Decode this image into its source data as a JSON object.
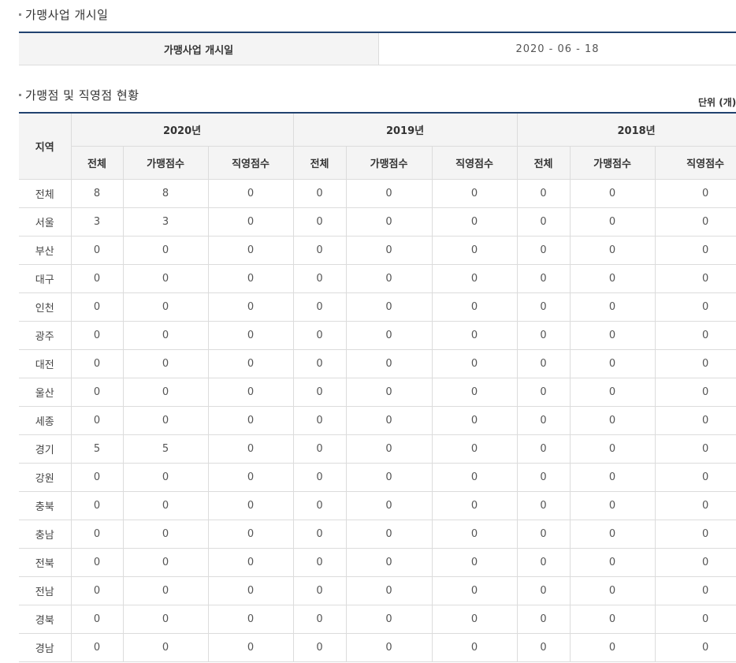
{
  "section1": {
    "title": "가맹사업 개시일",
    "label": "가맹사업 개시일",
    "value": "2020 - 06 - 18"
  },
  "section2": {
    "title": "가맹점 및 직영점 현황",
    "unit": "단위 (개)",
    "region_header": "지역",
    "years": [
      "2020년",
      "2019년",
      "2018년"
    ],
    "sub_headers": [
      "전체",
      "가맹점수",
      "직영점수"
    ],
    "rows": [
      {
        "region": "전체",
        "values": [
          "8",
          "8",
          "0",
          "0",
          "0",
          "0",
          "0",
          "0",
          "0"
        ]
      },
      {
        "region": "서울",
        "values": [
          "3",
          "3",
          "0",
          "0",
          "0",
          "0",
          "0",
          "0",
          "0"
        ]
      },
      {
        "region": "부산",
        "values": [
          "0",
          "0",
          "0",
          "0",
          "0",
          "0",
          "0",
          "0",
          "0"
        ]
      },
      {
        "region": "대구",
        "values": [
          "0",
          "0",
          "0",
          "0",
          "0",
          "0",
          "0",
          "0",
          "0"
        ]
      },
      {
        "region": "인천",
        "values": [
          "0",
          "0",
          "0",
          "0",
          "0",
          "0",
          "0",
          "0",
          "0"
        ]
      },
      {
        "region": "광주",
        "values": [
          "0",
          "0",
          "0",
          "0",
          "0",
          "0",
          "0",
          "0",
          "0"
        ]
      },
      {
        "region": "대전",
        "values": [
          "0",
          "0",
          "0",
          "0",
          "0",
          "0",
          "0",
          "0",
          "0"
        ]
      },
      {
        "region": "울산",
        "values": [
          "0",
          "0",
          "0",
          "0",
          "0",
          "0",
          "0",
          "0",
          "0"
        ]
      },
      {
        "region": "세종",
        "values": [
          "0",
          "0",
          "0",
          "0",
          "0",
          "0",
          "0",
          "0",
          "0"
        ]
      },
      {
        "region": "경기",
        "values": [
          "5",
          "5",
          "0",
          "0",
          "0",
          "0",
          "0",
          "0",
          "0"
        ]
      },
      {
        "region": "강원",
        "values": [
          "0",
          "0",
          "0",
          "0",
          "0",
          "0",
          "0",
          "0",
          "0"
        ]
      },
      {
        "region": "충북",
        "values": [
          "0",
          "0",
          "0",
          "0",
          "0",
          "0",
          "0",
          "0",
          "0"
        ]
      },
      {
        "region": "충남",
        "values": [
          "0",
          "0",
          "0",
          "0",
          "0",
          "0",
          "0",
          "0",
          "0"
        ]
      },
      {
        "region": "전북",
        "values": [
          "0",
          "0",
          "0",
          "0",
          "0",
          "0",
          "0",
          "0",
          "0"
        ]
      },
      {
        "region": "전남",
        "values": [
          "0",
          "0",
          "0",
          "0",
          "0",
          "0",
          "0",
          "0",
          "0"
        ]
      },
      {
        "region": "경북",
        "values": [
          "0",
          "0",
          "0",
          "0",
          "0",
          "0",
          "0",
          "0",
          "0"
        ]
      },
      {
        "region": "경남",
        "values": [
          "0",
          "0",
          "0",
          "0",
          "0",
          "0",
          "0",
          "0",
          "0"
        ]
      }
    ]
  },
  "colors": {
    "header_border": "#21426f",
    "header_bg": "#f4f4f4",
    "cell_border": "#dcdcdc"
  }
}
